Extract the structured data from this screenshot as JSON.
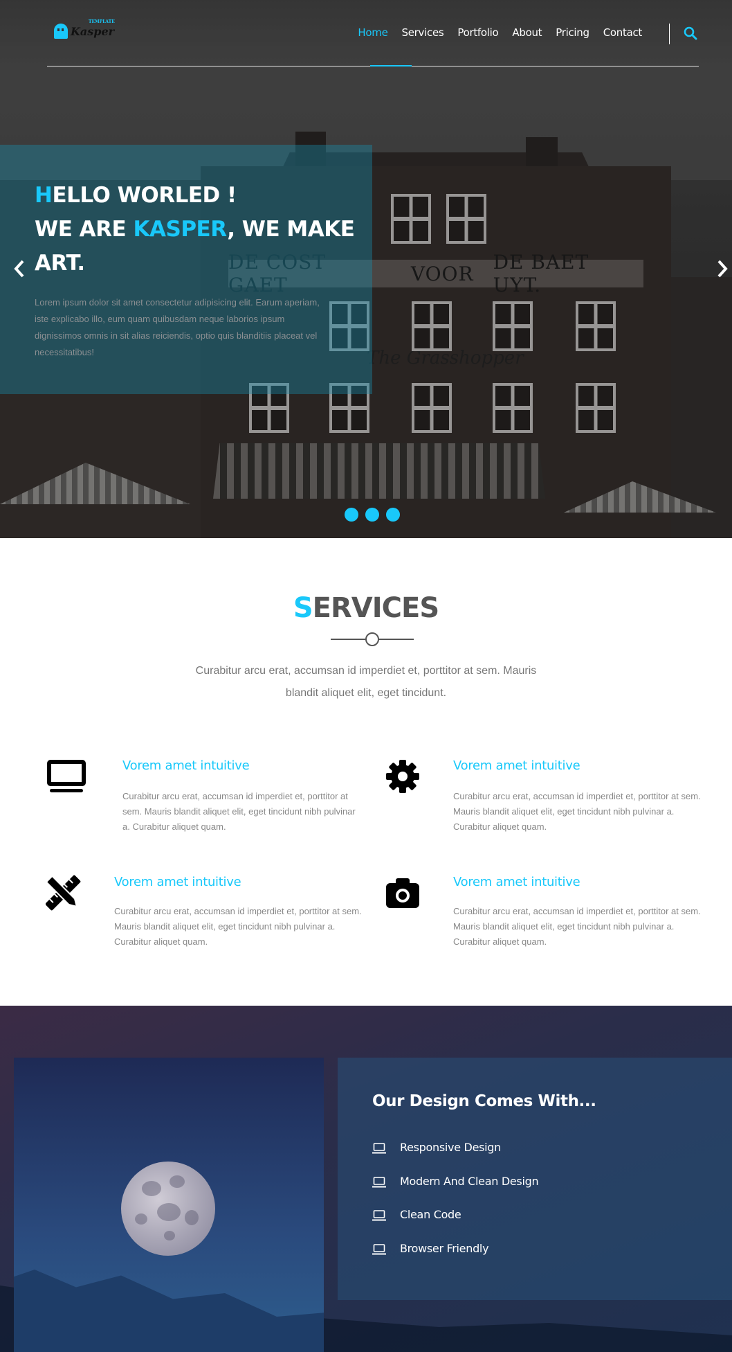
{
  "brand": {
    "name": "Kasper",
    "tagline": "TEMPLATE"
  },
  "nav": {
    "items": [
      {
        "label": "Home",
        "active": true
      },
      {
        "label": "Services",
        "active": false
      },
      {
        "label": "Portfolio",
        "active": false
      },
      {
        "label": "About",
        "active": false
      },
      {
        "label": "Pricing",
        "active": false
      },
      {
        "label": "Contact",
        "active": false
      }
    ],
    "search_icon": "search-icon"
  },
  "hero": {
    "line1_first": "H",
    "line1_rest": "ELLO WORLED !",
    "line2_pre": "WE ARE ",
    "line2_brand": "KASPER",
    "line2_post": ", WE MAKE",
    "line3": "ART.",
    "text": "Lorem ipsum dolor sit amet consectetur adipisicing elit. Earum aperiam, iste explicabo illo, eum quam quibusdam neque laborios ipsum dignissimos omnis in sit alias reiciendis, optio quis blanditiis placeat vel necessitatibus!",
    "sign": [
      "DE COST GAET",
      "VOOR",
      "DE BAET UYT."
    ],
    "script_sign": "The Grasshopper",
    "slides": 3
  },
  "services": {
    "title_first": "S",
    "title_rest": "ERVICES",
    "description": "Curabitur arcu erat, accumsan id imperdiet et, porttitor at sem. Mauris blandit aliquet elit, eget tincidunt.",
    "items": [
      {
        "icon": "desktop-icon",
        "title": "Vorem amet intuitive",
        "text": "Curabitur arcu erat, accumsan id imperdiet et, porttitor at sem. Mauris blandit aliquet elit, eget tincidunt nibh pulvinar a. Curabitur aliquet quam."
      },
      {
        "icon": "gear-icon",
        "title": "Vorem amet intuitive",
        "text": "Curabitur arcu erat, accumsan id imperdiet et, porttitor at sem. Mauris blandit aliquet elit, eget tincidunt nibh pulvinar a. Curabitur aliquet quam."
      },
      {
        "icon": "pencil-ruler-icon",
        "title": "Vorem amet intuitive",
        "text": "Curabitur arcu erat, accumsan id imperdiet et, porttitor at sem. Mauris blandit aliquet elit, eget tincidunt nibh pulvinar a. Curabitur aliquet quam."
      },
      {
        "icon": "camera-icon",
        "title": "Vorem amet intuitive",
        "text": "Curabitur arcu erat, accumsan id imperdiet et, porttitor at sem. Mauris blandit aliquet elit, eget tincidunt nibh pulvinar a. Curabitur aliquet quam."
      }
    ]
  },
  "design": {
    "title": "Our Design Comes With...",
    "features": [
      {
        "icon": "laptop-icon",
        "label": "Responsive Design"
      },
      {
        "icon": "laptop-icon",
        "label": "Modern And Clean Design"
      },
      {
        "icon": "laptop-icon",
        "label": "Clean Code"
      },
      {
        "icon": "laptop-icon",
        "label": "Browser Friendly"
      }
    ]
  },
  "colors": {
    "accent": "#19c8fa",
    "text": "#555555",
    "muted": "#888888"
  }
}
